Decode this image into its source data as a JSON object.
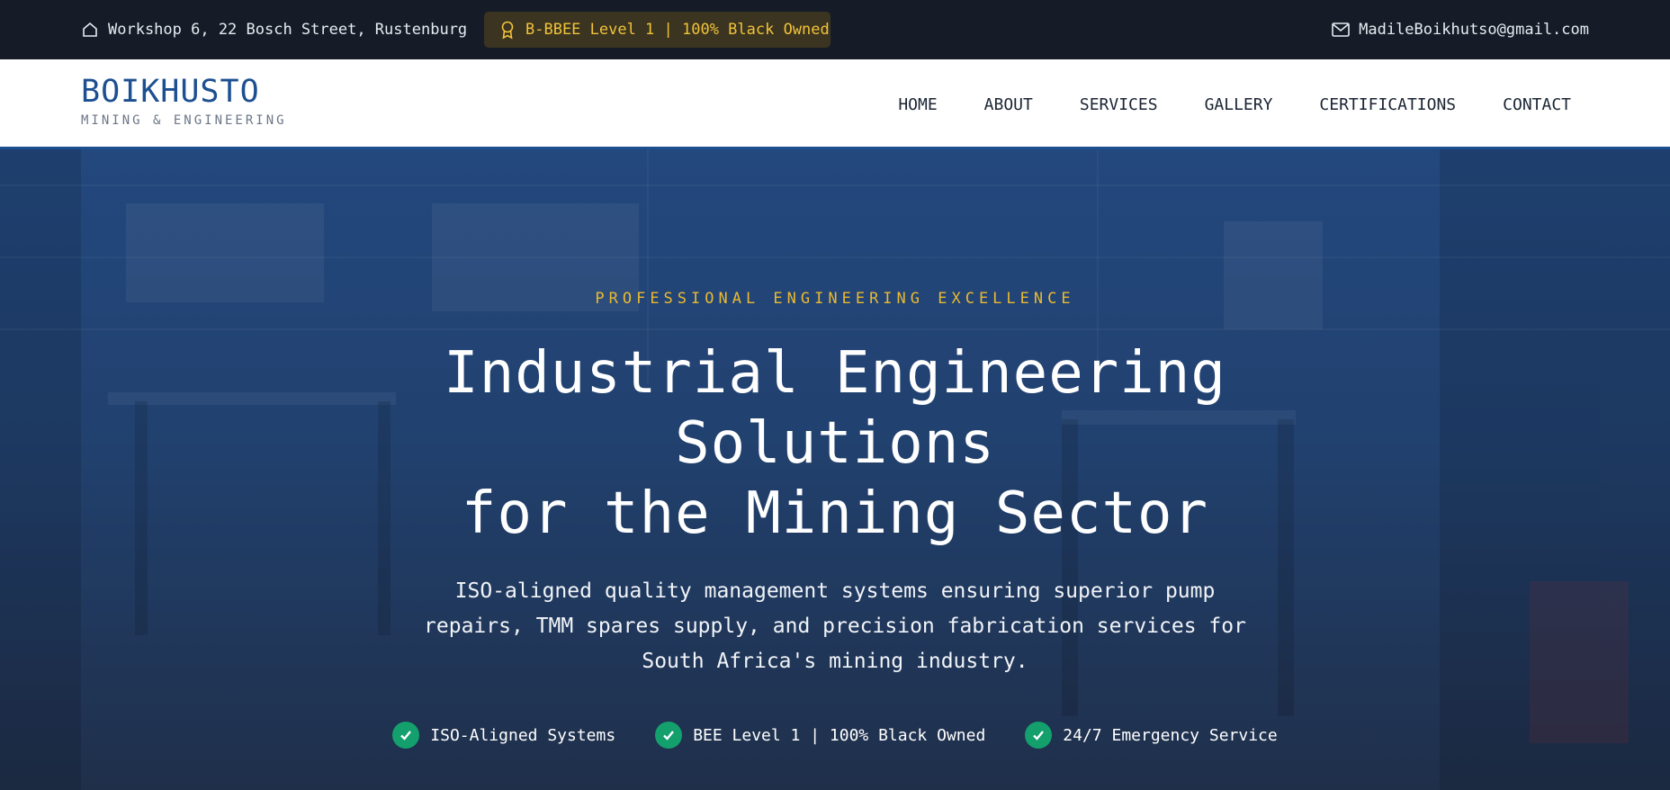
{
  "topbar": {
    "address": "Workshop 6, 22 Bosch Street, Rustenburg",
    "address_icon": "home-icon",
    "badge": "B-BBEE Level 1 | 100% Black Owned",
    "badge_icon": "award-icon",
    "email": "MadileBoikhutso@gmail.com",
    "email_icon": "mail-icon"
  },
  "brand": {
    "name": "BOIKHUSTO",
    "tagline": "MINING & ENGINEERING"
  },
  "nav": {
    "items": [
      "HOME",
      "ABOUT",
      "SERVICES",
      "GALLERY",
      "CERTIFICATIONS",
      "CONTACT"
    ]
  },
  "hero": {
    "eyebrow": "PROFESSIONAL ENGINEERING EXCELLENCE",
    "headline_line1": "Industrial Engineering",
    "headline_line2": "Solutions",
    "headline_line3": "for the Mining Sector",
    "lede": "ISO-aligned quality management systems ensuring superior pump repairs, TMM spares supply, and precision fabrication services for South Africa's mining industry.",
    "features": [
      "ISO-Aligned Systems",
      "BEE Level 1 | 100% Black Owned",
      "24/7 Emergency Service"
    ]
  },
  "colors": {
    "topbar_bg": "#151c28",
    "brand_blue": "#1d4f91",
    "accent_gold": "#e9b931",
    "check_green": "#14a06d"
  }
}
